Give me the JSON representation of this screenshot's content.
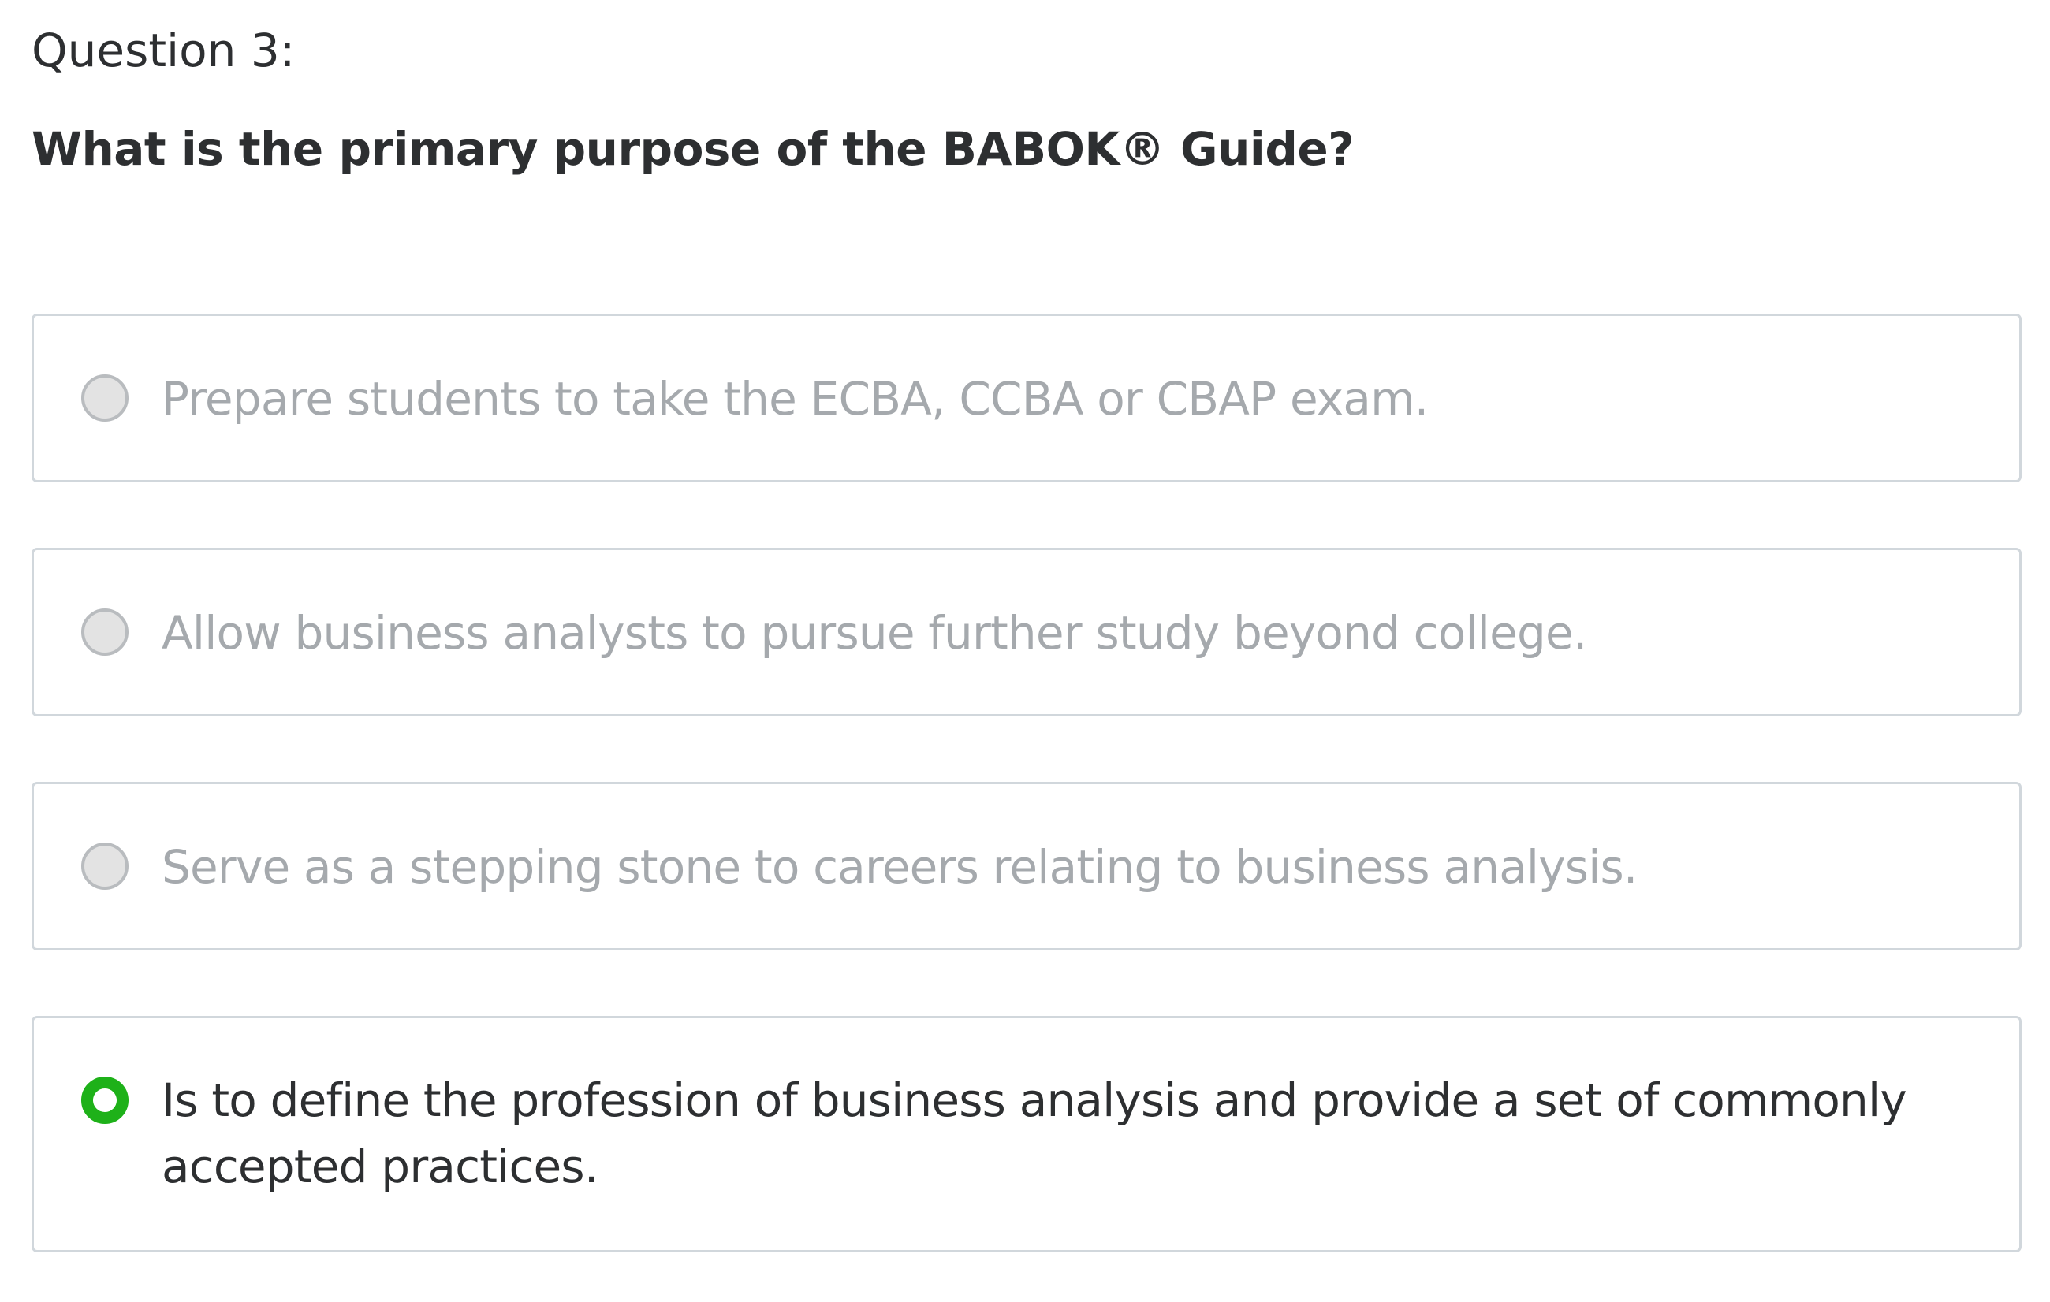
{
  "question": {
    "number_label": "Question 3:",
    "text": "What is the primary purpose of the BABOK® Guide?"
  },
  "options": [
    {
      "label": "Prepare students to take the ECBA, CCBA or CBAP exam.",
      "selected": false
    },
    {
      "label": "Allow business analysts to pursue further study beyond college.",
      "selected": false
    },
    {
      "label": "Serve as a stepping stone to careers relating to business analysis.",
      "selected": false
    },
    {
      "label": "Is to define the profession of business analysis and provide a set of commonly accepted practices.",
      "selected": true
    }
  ],
  "colors": {
    "selected_accent": "#1eb119",
    "option_border": "#d1d7dc",
    "muted_text": "#a5a9ad",
    "primary_text": "#2d2f31"
  }
}
